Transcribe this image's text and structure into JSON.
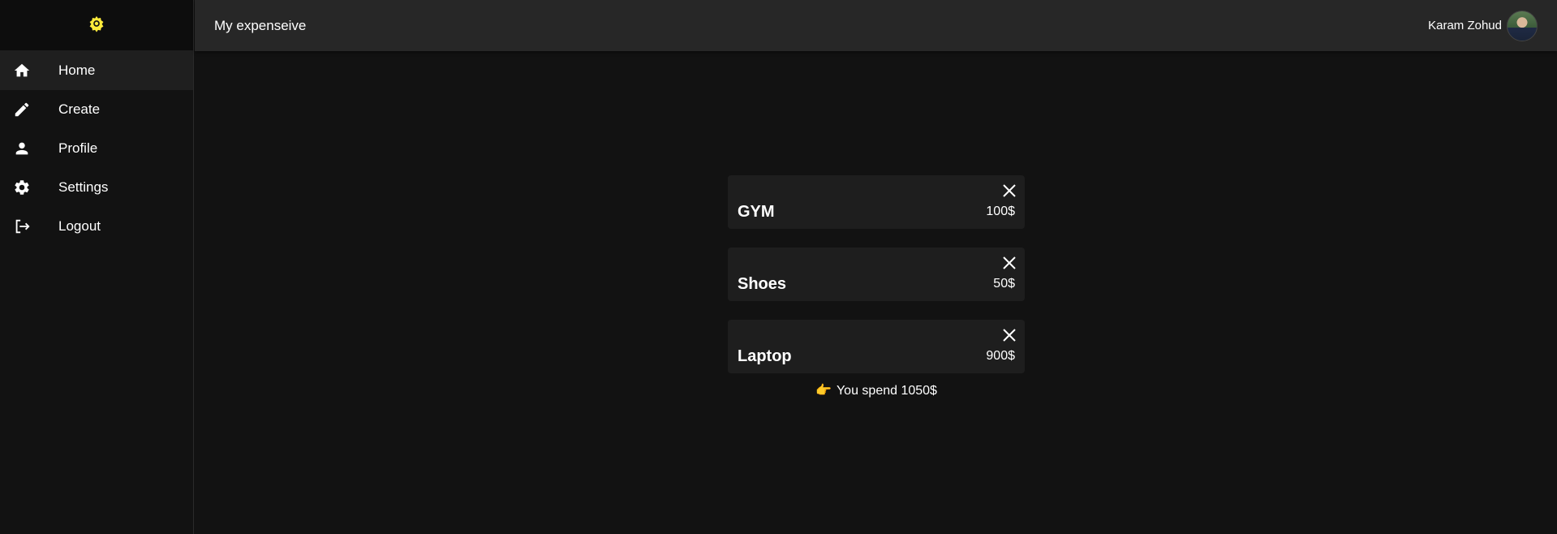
{
  "sidebar": {
    "logo_icon": "sun-gear-icon",
    "accent_color": "#ffeb3b",
    "items": [
      {
        "label": "Home",
        "icon": "home-icon",
        "active": true
      },
      {
        "label": "Create",
        "icon": "pencil-icon",
        "active": false
      },
      {
        "label": "Profile",
        "icon": "person-icon",
        "active": false
      },
      {
        "label": "Settings",
        "icon": "gear-icon",
        "active": false
      },
      {
        "label": "Logout",
        "icon": "logout-icon",
        "active": false
      }
    ]
  },
  "header": {
    "title": "My expenseive",
    "user_name": "Karam Zohud"
  },
  "expenses": [
    {
      "title": "GYM",
      "amount": "100$"
    },
    {
      "title": "Shoes",
      "amount": "50$"
    },
    {
      "title": "Laptop",
      "amount": "900$"
    }
  ],
  "summary": {
    "pointer": "👉",
    "text": "You spend 1050$"
  }
}
